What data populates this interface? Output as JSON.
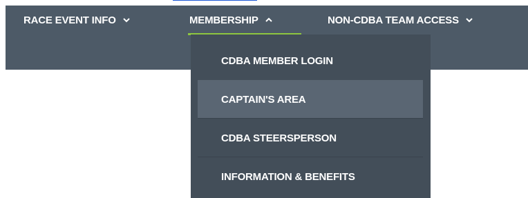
{
  "nav": {
    "items": [
      {
        "label": "RACE EVENT INFO",
        "chevron": "chevron-down"
      },
      {
        "label": "MEMBERSHIP",
        "chevron": "chevron-up",
        "active": true
      },
      {
        "label": "NON-CDBA TEAM ACCESS",
        "chevron": "chevron-down"
      }
    ]
  },
  "membership_menu": {
    "items": [
      {
        "label": "CDBA MEMBER LOGIN"
      },
      {
        "label": "CAPTAIN'S AREA",
        "highlighted": true
      },
      {
        "label": "CDBA STEERSPERSON"
      },
      {
        "label": "INFORMATION & BENEFITS"
      }
    ]
  },
  "colors": {
    "navbar_bg": "#4d5a67",
    "dropdown_bg": "#434e59",
    "highlight_bg": "#5a6673",
    "active_underline": "#8ec63f",
    "text": "#ffffff"
  }
}
